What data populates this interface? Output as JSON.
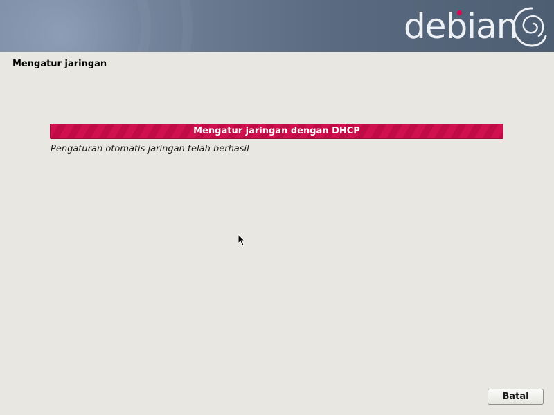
{
  "banner": {
    "logo_text": "debian",
    "logo_icon": "debian-swirl-icon",
    "accent_color": "#d70a53"
  },
  "page": {
    "title": "Mengatur jaringan"
  },
  "progress": {
    "label": "Mengatur jaringan dengan DHCP",
    "fraction": 1.0,
    "color": "#d1104f"
  },
  "status": {
    "message": "Pengaturan otomatis jaringan telah berhasil"
  },
  "buttons": {
    "cancel_label": "Batal"
  },
  "cursor": {
    "icon": "arrow-pointer-icon"
  }
}
